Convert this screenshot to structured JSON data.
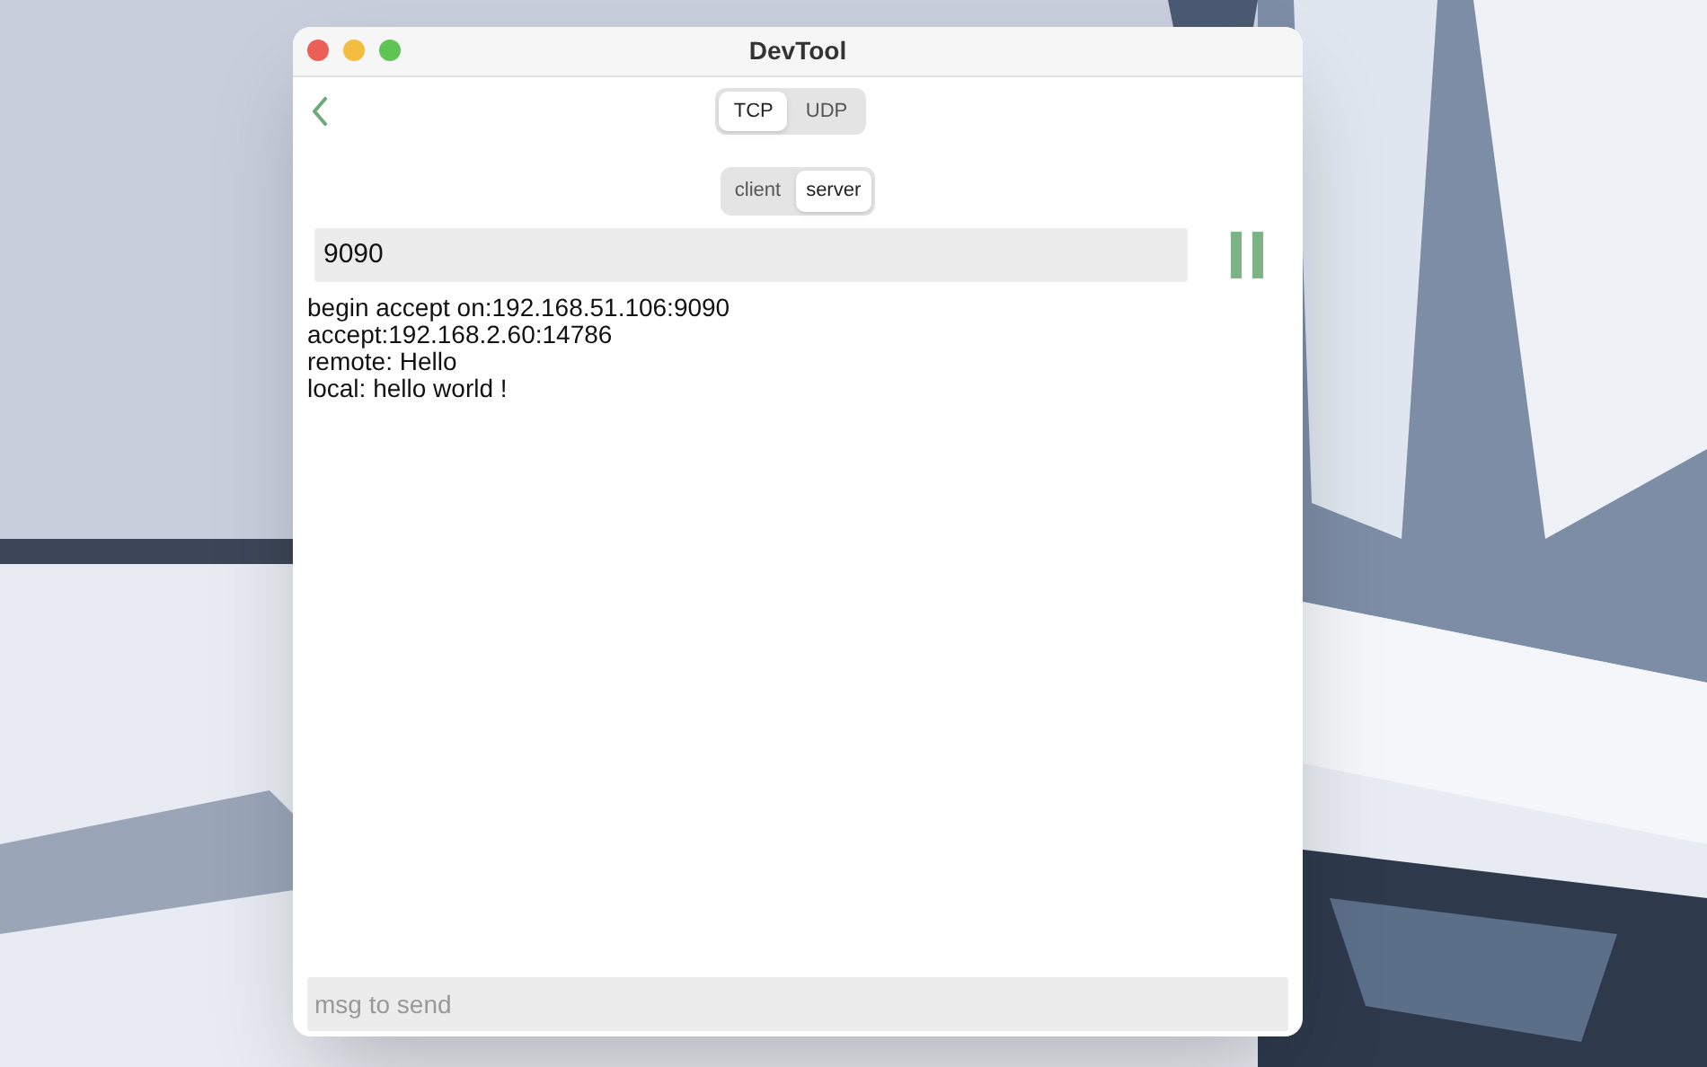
{
  "window": {
    "title": "DevTool"
  },
  "protocol_tabs": [
    {
      "label": "TCP",
      "selected": true
    },
    {
      "label": "UDP",
      "selected": false
    }
  ],
  "mode_tabs": [
    {
      "label": "client",
      "selected": false
    },
    {
      "label": "server",
      "selected": true
    }
  ],
  "port_field": {
    "value": "9090"
  },
  "running": true,
  "log": [
    "begin accept on:192.168.51.106:9090",
    "accept:192.168.2.60:14786",
    "remote: Hello",
    "local: hello world !"
  ],
  "message_field": {
    "placeholder": "msg to send"
  }
}
